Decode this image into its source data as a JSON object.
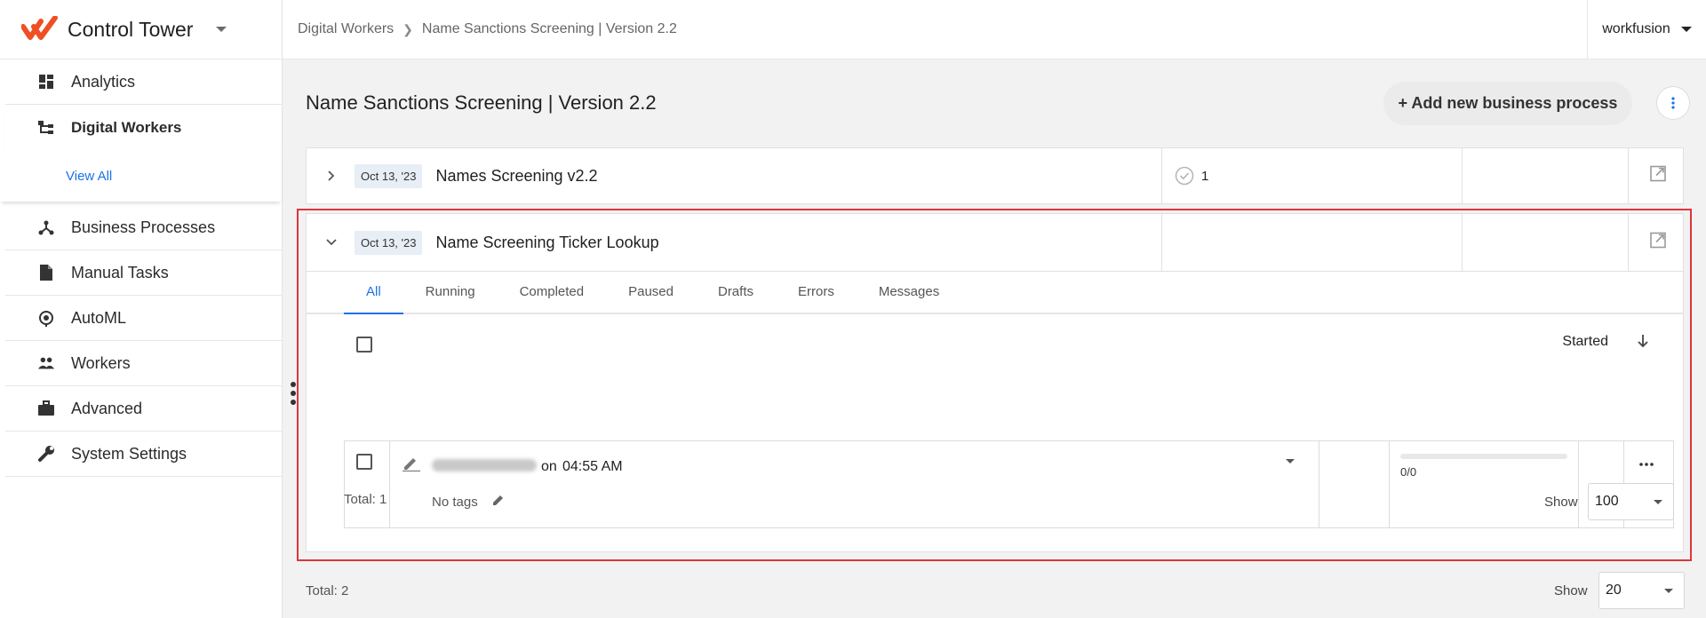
{
  "brand": {
    "title": "Control Tower",
    "logo_color": "#f04e23"
  },
  "sidebar": {
    "items": [
      {
        "label": "Analytics",
        "icon": "dashboard-icon"
      },
      {
        "label": "Digital Workers",
        "icon": "hierarchy-icon",
        "active": true
      },
      {
        "label": "Business Processes",
        "icon": "process-icon"
      },
      {
        "label": "Manual Tasks",
        "icon": "document-icon"
      },
      {
        "label": "AutoML",
        "icon": "automl-icon"
      },
      {
        "label": "Workers",
        "icon": "people-icon"
      },
      {
        "label": "Advanced",
        "icon": "briefcase-icon"
      },
      {
        "label": "System Settings",
        "icon": "wrench-icon"
      }
    ],
    "sub_item": "View All"
  },
  "breadcrumb": {
    "items": [
      "Digital Workers",
      "Name Sanctions Screening | Version 2.2"
    ]
  },
  "account": {
    "name": "workfusion"
  },
  "page": {
    "title": "Name Sanctions Screening | Version 2.2",
    "add_button": "+ Add new business process"
  },
  "processes": [
    {
      "date": "Oct 13, '23",
      "title": "Names Screening v2.2",
      "count": "1"
    },
    {
      "date": "Oct 13, '23",
      "title": "Name Screening Ticker Lookup"
    }
  ],
  "tabs": [
    "All",
    "Running",
    "Completed",
    "Paused",
    "Drafts",
    "Errors",
    "Messages"
  ],
  "task_table": {
    "sort_label": "Started",
    "row": {
      "on_text": "on",
      "time": "04:55 AM",
      "tags": "No tags",
      "progress": "0/0",
      "progress_fraction": 0
    },
    "total": "Total: 1",
    "show_label": "Show",
    "show_value": "100"
  },
  "footer": {
    "total": "Total: 2",
    "show_label": "Show",
    "show_value": "20"
  },
  "colors": {
    "accent": "#1a73e8",
    "highlight": "#e0353b",
    "badge_bg": "#e7eef5"
  }
}
